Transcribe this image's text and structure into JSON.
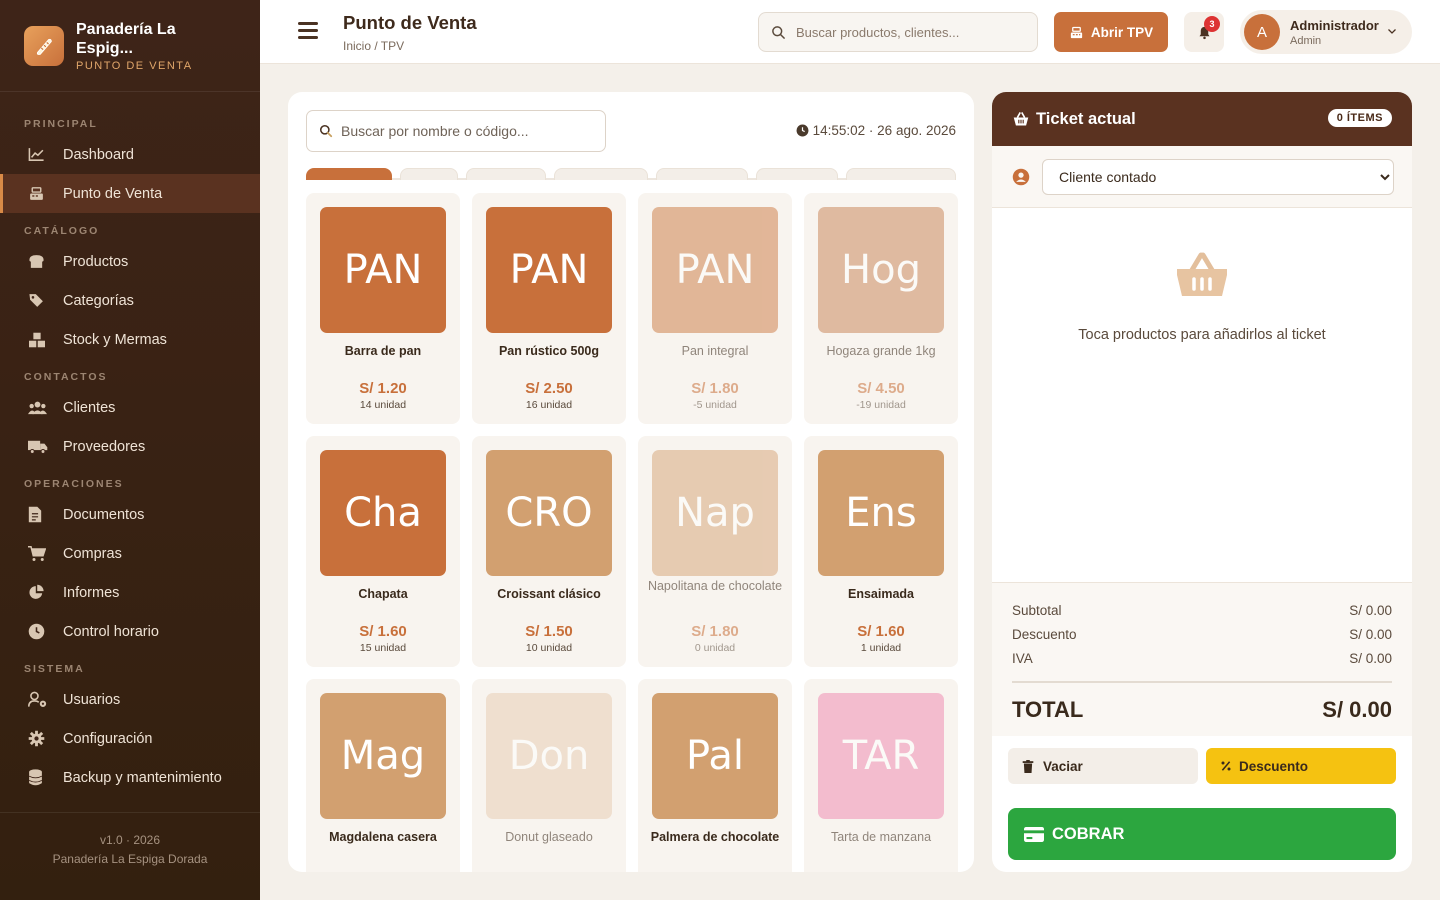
{
  "brand": {
    "name": "Panadería La Espig...",
    "subtitle": "PUNTO DE VENTA",
    "logo_icon": "bread-icon"
  },
  "sidebar": {
    "sections": [
      {
        "label": "PRINCIPAL",
        "items": [
          {
            "label": "Dashboard",
            "icon": "chart-line-icon"
          },
          {
            "label": "Punto de Venta",
            "icon": "cash-register-icon",
            "active": true
          }
        ]
      },
      {
        "label": "CATÁLOGO",
        "items": [
          {
            "label": "Productos",
            "icon": "bread-slice-icon"
          },
          {
            "label": "Categorías",
            "icon": "tags-icon"
          },
          {
            "label": "Stock y Mermas",
            "icon": "boxes-icon"
          }
        ]
      },
      {
        "label": "CONTACTOS",
        "items": [
          {
            "label": "Clientes",
            "icon": "users-icon"
          },
          {
            "label": "Proveedores",
            "icon": "truck-icon"
          }
        ]
      },
      {
        "label": "OPERACIONES",
        "items": [
          {
            "label": "Documentos",
            "icon": "file-icon"
          },
          {
            "label": "Compras",
            "icon": "cart-icon"
          },
          {
            "label": "Informes",
            "icon": "pie-chart-icon"
          },
          {
            "label": "Control horario",
            "icon": "clock-icon"
          }
        ]
      },
      {
        "label": "SISTEMA",
        "items": [
          {
            "label": "Usuarios",
            "icon": "user-gear-icon"
          },
          {
            "label": "Configuración",
            "icon": "gear-icon"
          },
          {
            "label": "Backup y mantenimiento",
            "icon": "database-icon"
          }
        ]
      }
    ],
    "footer_version": "v1.0 · 2026",
    "footer_name": "Panadería La Espiga Dorada"
  },
  "header": {
    "title": "Punto de Venta",
    "breadcrumb": "Inicio / TPV",
    "search_placeholder": "Buscar productos, clientes...",
    "open_tpv_label": "Abrir TPV",
    "notifications_count": "3",
    "user_name": "Administrador",
    "user_role": "Admin",
    "user_initial": "A"
  },
  "pos": {
    "search_placeholder": "Buscar por nombre o código...",
    "datetime": "14:55:02 · 26 ago. 2026",
    "products": [
      {
        "abbr": "PAN",
        "name": "Barra de pan",
        "price": "S/ 1.20",
        "stock": "14 unidad",
        "color": "#c8703b",
        "dim": false
      },
      {
        "abbr": "PAN",
        "name": "Pan rústico 500g",
        "price": "S/ 2.50",
        "stock": "16 unidad",
        "color": "#c8703b",
        "dim": false
      },
      {
        "abbr": "PAN",
        "name": "Pan integral",
        "price": "S/ 1.80",
        "stock": "-5 unidad",
        "color": "#cf8450",
        "dim": true
      },
      {
        "abbr": "Hog",
        "name": "Hogaza grande 1kg",
        "price": "S/ 4.50",
        "stock": "-19 unidad",
        "color": "#cb8b61",
        "dim": true
      },
      {
        "abbr": "Cha",
        "name": "Chapata",
        "price": "S/ 1.60",
        "stock": "15 unidad",
        "color": "#c8703b",
        "dim": false
      },
      {
        "abbr": "CRO",
        "name": "Croissant clásico",
        "price": "S/ 1.50",
        "stock": "10 unidad",
        "color": "#d2a070",
        "dim": false
      },
      {
        "abbr": "Nap",
        "name": "Napolitana de chocolate",
        "price": "S/ 1.80",
        "stock": "0 unidad",
        "color": "#d9aa7f",
        "dim": true
      },
      {
        "abbr": "Ens",
        "name": "Ensaimada",
        "price": "S/ 1.60",
        "stock": "1 unidad",
        "color": "#d2a070",
        "dim": false
      },
      {
        "abbr": "Mag",
        "name": "Magdalena casera",
        "price": "",
        "stock": "",
        "color": "#d2a070",
        "dim": false
      },
      {
        "abbr": "Don",
        "name": "Donut glaseado",
        "price": "",
        "stock": "",
        "color": "#e8cfb6",
        "dim": true
      },
      {
        "abbr": "Pal",
        "name": "Palmera de chocolate",
        "price": "",
        "stock": "",
        "color": "#d2a070",
        "dim": false
      },
      {
        "abbr": "TAR",
        "name": "Tarta de manzana",
        "price": "",
        "stock": "",
        "color": "#f08fb4",
        "dim": true
      }
    ]
  },
  "ticket": {
    "title": "Ticket actual",
    "items_count": "0 ÍTEMS",
    "client_selected": "Cliente contado",
    "empty_message": "Toca productos para añadirlos al ticket",
    "subtotal_label": "Subtotal",
    "subtotal_value": "S/ 0.00",
    "discount_label": "Descuento",
    "discount_value": "S/ 0.00",
    "tax_label": "IVA",
    "tax_value": "S/ 0.00",
    "total_label": "TOTAL",
    "total_value": "S/ 0.00",
    "clear_label": "Vaciar",
    "discount_button_label": "Descuento",
    "charge_label": "COBRAR"
  }
}
